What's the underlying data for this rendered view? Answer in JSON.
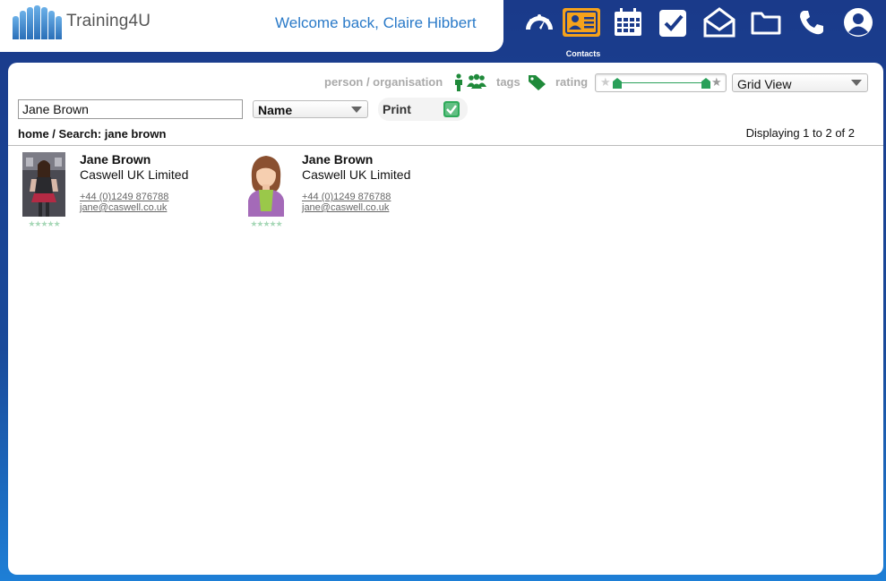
{
  "header": {
    "logo_text": "Training4U",
    "welcome": "Welcome back, Claire Hibbert"
  },
  "nav": {
    "items": [
      {
        "icon": "dashboard-icon"
      },
      {
        "icon": "contacts-icon",
        "label": "Contacts",
        "active": true
      },
      {
        "icon": "calendar-icon"
      },
      {
        "icon": "tasks-icon"
      },
      {
        "icon": "mail-icon"
      },
      {
        "icon": "folder-icon"
      },
      {
        "icon": "phone-icon"
      },
      {
        "icon": "user-icon"
      }
    ],
    "active_label": "Contacts"
  },
  "filters": {
    "person_org_label": "person / organisation",
    "tags_label": "tags",
    "rating_label": "rating",
    "view_selected": "Grid View"
  },
  "search": {
    "value": "Jane Brown",
    "field_selected": "Name",
    "print_label": "Print",
    "print_checked": true
  },
  "breadcrumb": "home / Search: jane brown",
  "displaying": "Displaying 1 to 2 of 2",
  "contacts": [
    {
      "name": "Jane Brown",
      "org": "Caswell UK Limited",
      "phone": "+44 (0)1249 876788",
      "email": "jane@caswell.co.uk",
      "stars": "★★★★★"
    },
    {
      "name": "Jane Brown",
      "org": "Caswell UK Limited",
      "phone": "+44 (0)1249 876788",
      "email": "jane@caswell.co.uk",
      "stars": "★★★★★"
    }
  ],
  "colors": {
    "accent": "#f5a21b",
    "brand_blue": "#1a3a8a",
    "link_blue": "#2a7ac8",
    "green": "#2aa05a"
  }
}
